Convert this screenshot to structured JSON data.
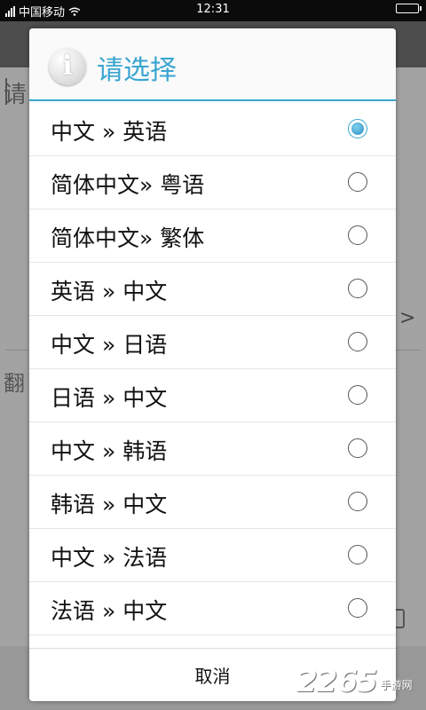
{
  "status_bar": {
    "carrier": "中国移动",
    "time": "12:31"
  },
  "background": {
    "input_placeholder_fragment": "请",
    "result_label_fragment": "翻",
    "arrow": ">"
  },
  "dialog": {
    "title": "请选择",
    "info_icon_glyph": "i",
    "options": [
      {
        "label": "中文 » 英语",
        "selected": true
      },
      {
        "label": "简体中文» 粤语",
        "selected": false
      },
      {
        "label": "简体中文» 繁体",
        "selected": false
      },
      {
        "label": "英语 » 中文",
        "selected": false
      },
      {
        "label": "中文 » 日语",
        "selected": false
      },
      {
        "label": "日语 » 中文",
        "selected": false
      },
      {
        "label": "中文 » 韩语",
        "selected": false
      },
      {
        "label": "韩语 » 中文",
        "selected": false
      },
      {
        "label": "中文 » 法语",
        "selected": false
      },
      {
        "label": "法语 » 中文",
        "selected": false
      }
    ],
    "cancel_label": "取消"
  },
  "watermark": {
    "number": "2265",
    "sub": "手游网"
  },
  "colors": {
    "accent": "#39a5d0"
  }
}
